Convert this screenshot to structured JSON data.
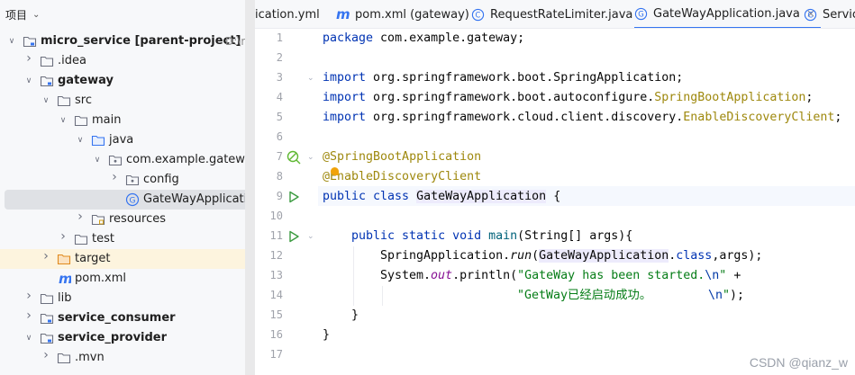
{
  "project_panel": {
    "title": "项目",
    "tree": [
      {
        "label": "micro_service [parent-project]",
        "suffix": "D:\\micr",
        "icon": "module-folder-icon",
        "arrow": "down",
        "depth": 0
      },
      {
        "label": ".idea",
        "icon": "folder-icon",
        "arrow": "right",
        "depth": 1
      },
      {
        "label": "gateway",
        "icon": "module-folder-icon",
        "arrow": "down",
        "depth": 1
      },
      {
        "label": "src",
        "icon": "folder-icon",
        "arrow": "down",
        "depth": 2
      },
      {
        "label": "main",
        "icon": "folder-icon",
        "arrow": "down",
        "depth": 3
      },
      {
        "label": "java",
        "icon": "source-folder-icon",
        "arrow": "down",
        "depth": 4
      },
      {
        "label": "com.example.gateway",
        "icon": "package-icon",
        "arrow": "down",
        "depth": 5
      },
      {
        "label": "config",
        "icon": "package-icon",
        "arrow": "right",
        "depth": 6
      },
      {
        "label": "GateWayApplication",
        "icon": "spring-class-icon",
        "arrow": "none",
        "depth": 6
      },
      {
        "label": "resources",
        "icon": "resources-folder-icon",
        "arrow": "right",
        "depth": 4
      },
      {
        "label": "test",
        "icon": "folder-icon",
        "arrow": "right",
        "depth": 3
      },
      {
        "label": "target",
        "icon": "excluded-folder-icon",
        "arrow": "right",
        "depth": 2
      },
      {
        "label": "pom.xml",
        "icon": "maven-icon",
        "arrow": "none",
        "depth": 2
      },
      {
        "label": "lib",
        "icon": "folder-icon",
        "arrow": "right",
        "depth": 1
      },
      {
        "label": "service_consumer",
        "icon": "module-folder-icon",
        "arrow": "right",
        "depth": 1
      },
      {
        "label": "service_provider",
        "icon": "module-folder-icon",
        "arrow": "down",
        "depth": 1
      },
      {
        "label": ".mvn",
        "icon": "folder-icon",
        "arrow": "right",
        "depth": 2
      }
    ]
  },
  "tabs": [
    {
      "label": "ication.yml",
      "icon": "none"
    },
    {
      "label": "pom.xml (gateway)",
      "icon": "maven-icon"
    },
    {
      "label": "RequestRateLimiter.java",
      "icon": "class-icon"
    },
    {
      "label": "GateWayApplication.java",
      "icon": "spring-class-icon",
      "close": "×"
    },
    {
      "label": "Servic",
      "icon": "class-icon"
    }
  ],
  "editor": {
    "line_numbers": [
      "1",
      "2",
      "3",
      "4",
      "5",
      "6",
      "7",
      "8",
      "9",
      "10",
      "11",
      "12",
      "13",
      "14",
      "15",
      "16",
      "17"
    ],
    "code": {
      "l1_kw": "package",
      "l1_rest": " com.example.gateway;",
      "l3_kw": "import",
      "l3_rest": " org.springframework.boot.SpringApplication;",
      "l4_kw": "import",
      "l4_a": " org.springframework.boot.autoconfigure.",
      "l4_b": "SpringBootApplication",
      "l4_c": ";",
      "l5_kw": "import",
      "l5_a": " org.springframework.cloud.client.discovery.",
      "l5_b": "EnableDiscoveryClient",
      "l5_c": ";",
      "l7": "@SpringBootApplication",
      "l8": "@EnableDiscoveryClient",
      "l9_kw": "public class",
      "l9_sp": " ",
      "l9_cls": "GateWayApplication",
      "l9_end": " {",
      "l11_kw": "public static void",
      "l11_sp": " ",
      "l11_m": "main",
      "l11_rest": "(String[] args){",
      "l12_a": "SpringApplication.",
      "l12_b": "run",
      "l12_c": "(",
      "l12_d": "GateWayApplication",
      "l12_e": ".",
      "l12_f": "class",
      "l12_g": ",args);",
      "l13_a": "System.",
      "l13_b": "out",
      "l13_c": ".println(",
      "l13_d": "\"GateWay has been started.",
      "l13_e": "\\n",
      "l13_f": "\"",
      "l13_g": " +",
      "l14_a": "\"GetWay已经启动成功。",
      "l14_b": "\\n",
      "l14_c": "\"",
      "l14_d": ");",
      "l15": "}",
      "l16": "}"
    }
  },
  "watermark": "CSDN @qianz_w"
}
